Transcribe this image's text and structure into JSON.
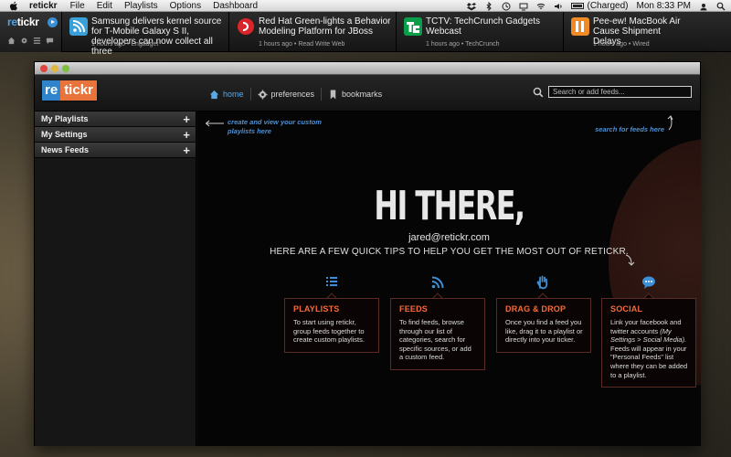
{
  "menubar": {
    "app_name": "retickr",
    "items": [
      "File",
      "Edit",
      "Playlists",
      "Options",
      "Dashboard"
    ],
    "battery": "(Charged)",
    "clock": "Mon 8:33 PM"
  },
  "ticker": {
    "logo_re": "re",
    "logo_tickr": "tickr",
    "items": [
      {
        "headline": "Samsung delivers kernel source for T-Mobile Galaxy S II, developers can now collect all three",
        "meta": "1 hours ago • Engadget",
        "icon": "rss-icon",
        "color": "#3aa0d8"
      },
      {
        "headline": "Red Hat Green-lights a Behavior Modeling Platform for JBoss",
        "meta": "1 hours ago • Read Write Web",
        "icon": "readwriteweb-icon",
        "color": "#d8262a"
      },
      {
        "headline": "TCTV: TechCrunch Gadgets Webcast",
        "meta": "1 hours ago • TechCrunch",
        "icon": "techcrunch-icon",
        "color": "#0a9e4a"
      },
      {
        "headline": "Pee-ew! MacBook Air Cause Shipment Delays",
        "meta": "1 hours ago • Wired",
        "icon": "wired-icon",
        "color": "#f08a24"
      }
    ]
  },
  "app": {
    "logo_re": "re",
    "logo_tickr": "tickr",
    "nav": [
      {
        "label": "home",
        "icon": "home-icon",
        "active": true
      },
      {
        "label": "preferences",
        "icon": "gear-icon",
        "active": false
      },
      {
        "label": "bookmarks",
        "icon": "bookmark-icon",
        "active": false
      }
    ],
    "search_placeholder": "Search or add feeds..."
  },
  "sidebar": {
    "items": [
      {
        "label": "My Playlists"
      },
      {
        "label": "My Settings"
      },
      {
        "label": "News Feeds"
      }
    ]
  },
  "main": {
    "hint_left": "create and view your custom playlists here",
    "hint_right": "search for feeds here",
    "title": "HI THERE,",
    "email": "jared@retickr.com",
    "tips_line": "HERE ARE A FEW QUICK TIPS TO HELP YOU GET THE MOST OUT OF RETICKR.",
    "cards": [
      {
        "title": "PLAYLISTS",
        "text": "To start using retickr, group feeds together to create custom playlists.",
        "icon": "list-icon"
      },
      {
        "title": "FEEDS",
        "text": "To find feeds, browse through our list of categories, search for specific sources, or add a custom feed.",
        "icon": "rss-icon"
      },
      {
        "title": "DRAG & DROP",
        "text": "Once you find a feed you like, drag it to a playlist or directly into your ticker.",
        "icon": "hand-icon"
      },
      {
        "title": "SOCIAL",
        "text_1": "Link your facebook and twitter accounts ",
        "text_em": "(My Settings > Social Media).",
        "text_2": " Feeds will appear in your \"Personal Feeds\" list where they can be added to a playlist.",
        "icon": "chat-bubble-icon"
      }
    ]
  },
  "colors": {
    "accent_blue": "#4ba3e6",
    "accent_orange": "#f36b3b"
  }
}
